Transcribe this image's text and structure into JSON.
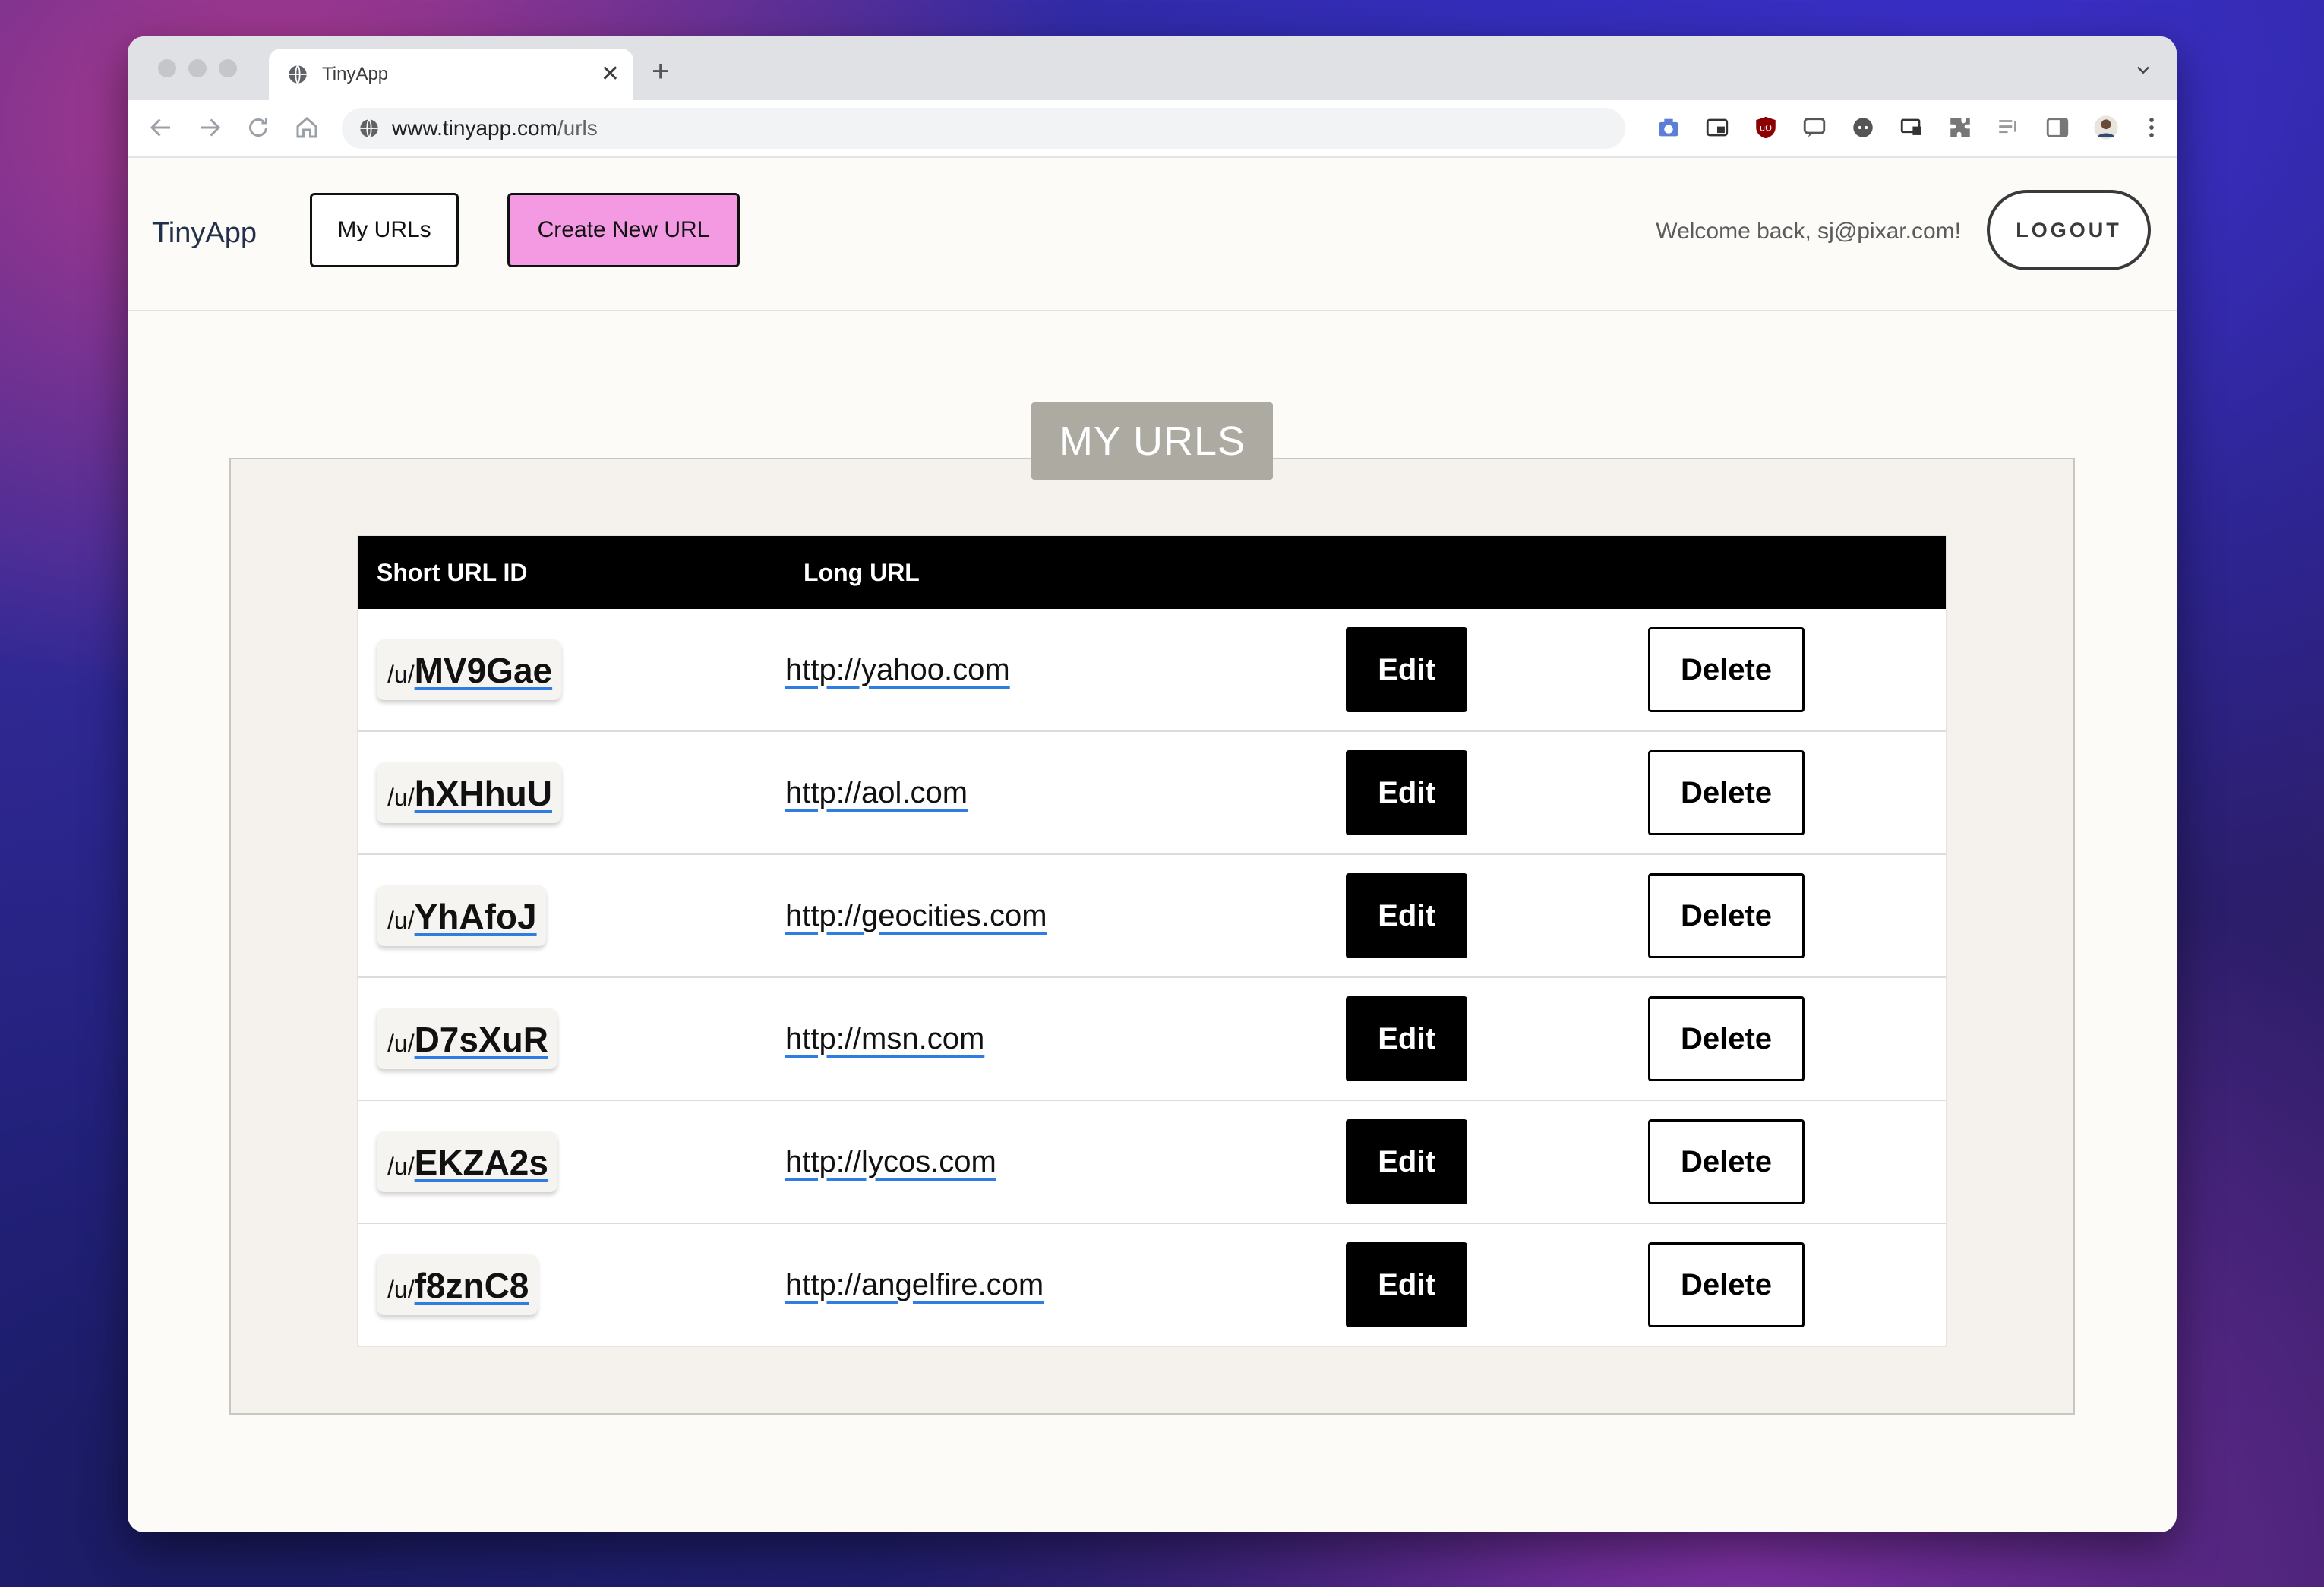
{
  "browser": {
    "tab_title": "TinyApp",
    "tab_icon": "globe-icon",
    "url_host": "www.tinyapp.com",
    "url_path": "/urls",
    "extension_icons": [
      "camera-icon",
      "picture-in-picture-icon",
      "ublock-icon",
      "translate-icon",
      "chat-icon",
      "cast-icon",
      "extensions-puzzle-icon",
      "reading-list-icon",
      "sidebar-icon",
      "profile-avatar"
    ]
  },
  "nav": {
    "brand": "TinyApp",
    "my_urls_label": "My URLs",
    "create_label": "Create New URL",
    "welcome": "Welcome back, sj@pixar.com!",
    "logout_label": "LOGOUT"
  },
  "colors": {
    "create_button_bg": "#f49ae3",
    "title_badge_bg": "#adaaa2",
    "table_header_bg": "#000000",
    "link_underline": "#2f7de1"
  },
  "main": {
    "section_title": "MY URLS",
    "table": {
      "headers": [
        "Short URL ID",
        "Long URL",
        "",
        ""
      ],
      "edit_label": "Edit",
      "delete_label": "Delete",
      "rows": [
        {
          "prefix": "/u/",
          "short_id": "MV9Gae",
          "long_url": "http://yahoo.com"
        },
        {
          "prefix": "/u/",
          "short_id": "hXHhuU",
          "long_url": "http://aol.com"
        },
        {
          "prefix": "/u/",
          "short_id": "YhAfoJ",
          "long_url": "http://geocities.com"
        },
        {
          "prefix": "/u/",
          "short_id": "D7sXuR",
          "long_url": "http://msn.com"
        },
        {
          "prefix": "/u/",
          "short_id": "EKZA2s",
          "long_url": "http://lycos.com"
        },
        {
          "prefix": "/u/",
          "short_id": "f8znC8",
          "long_url": "http://angelfire.com"
        }
      ]
    }
  }
}
